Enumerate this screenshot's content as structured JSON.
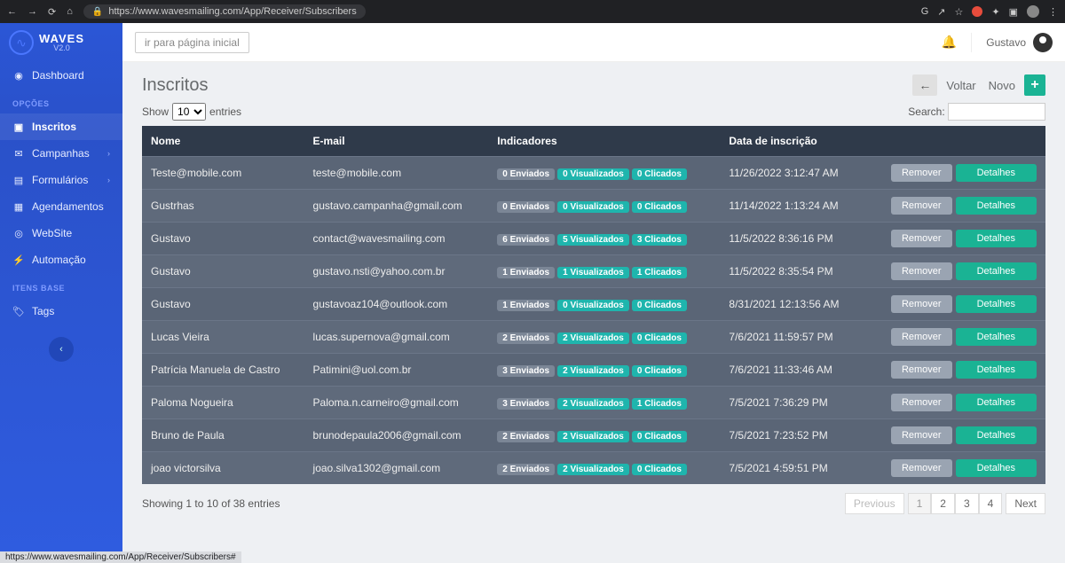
{
  "browser": {
    "url": "https://www.wavesmailing.com/App/Receiver/Subscribers",
    "status_url": "https://www.wavesmailing.com/App/Receiver/Subscribers#"
  },
  "brand": {
    "name": "WAVES",
    "version": "V2.0"
  },
  "sidebar": {
    "section_opcoes": "OPÇÕES",
    "section_itens": "ITENS BASE",
    "dashboard": "Dashboard",
    "inscritos": "Inscritos",
    "campanhas": "Campanhas",
    "formularios": "Formulários",
    "agendamentos": "Agendamentos",
    "website": "WebSite",
    "automacao": "Automação",
    "tags": "Tags"
  },
  "topbar": {
    "home": "ir para página inicial",
    "user": "Gustavo"
  },
  "page": {
    "title": "Inscritos",
    "back": "Voltar",
    "novo": "Novo",
    "show_prefix": "Show",
    "show_suffix": "entries",
    "page_size": "10",
    "search_label": "Search:",
    "info": "Showing 1 to 10 of 38 entries"
  },
  "columns": {
    "nome": "Nome",
    "email": "E-mail",
    "indicadores": "Indicadores",
    "data": "Data de inscrição"
  },
  "labels": {
    "enviados": "Enviados",
    "visualizados": "Visualizados",
    "clicados": "Clicados",
    "remover": "Remover",
    "detalhes": "Detalhes"
  },
  "pagination": {
    "prev": "Previous",
    "next": "Next",
    "pages": [
      "1",
      "2",
      "3",
      "4"
    ],
    "active": "1"
  },
  "rows": [
    {
      "nome": "Teste@mobile.com",
      "email": "teste@mobile.com",
      "env": 0,
      "vis": 0,
      "cli": 0,
      "data": "11/26/2022 3:12:47 AM"
    },
    {
      "nome": "Gustrhas",
      "email": "gustavo.campanha@gmail.com",
      "env": 0,
      "vis": 0,
      "cli": 0,
      "data": "11/14/2022 1:13:24 AM"
    },
    {
      "nome": "Gustavo",
      "email": "contact@wavesmailing.com",
      "env": 6,
      "vis": 5,
      "cli": 3,
      "data": "11/5/2022 8:36:16 PM"
    },
    {
      "nome": "Gustavo",
      "email": "gustavo.nsti@yahoo.com.br",
      "env": 1,
      "vis": 1,
      "cli": 1,
      "data": "11/5/2022 8:35:54 PM"
    },
    {
      "nome": "Gustavo",
      "email": "gustavoaz104@outlook.com",
      "env": 1,
      "vis": 0,
      "cli": 0,
      "data": "8/31/2021 12:13:56 AM"
    },
    {
      "nome": "Lucas Vieira",
      "email": "lucas.supernova@gmail.com",
      "env": 2,
      "vis": 2,
      "cli": 0,
      "data": "7/6/2021 11:59:57 PM"
    },
    {
      "nome": "Patrícia Manuela de Castro",
      "email": "Patimini@uol.com.br",
      "env": 3,
      "vis": 2,
      "cli": 0,
      "data": "7/6/2021 11:33:46 AM"
    },
    {
      "nome": "Paloma Nogueira",
      "email": "Paloma.n.carneiro@gmail.com",
      "env": 3,
      "vis": 2,
      "cli": 1,
      "data": "7/5/2021 7:36:29 PM"
    },
    {
      "nome": "Bruno de Paula",
      "email": "brunodepaula2006@gmail.com",
      "env": 2,
      "vis": 2,
      "cli": 0,
      "data": "7/5/2021 7:23:52 PM"
    },
    {
      "nome": "joao victorsilva",
      "email": "joao.silva1302@gmail.com",
      "env": 2,
      "vis": 2,
      "cli": 0,
      "data": "7/5/2021 4:59:51 PM"
    }
  ]
}
